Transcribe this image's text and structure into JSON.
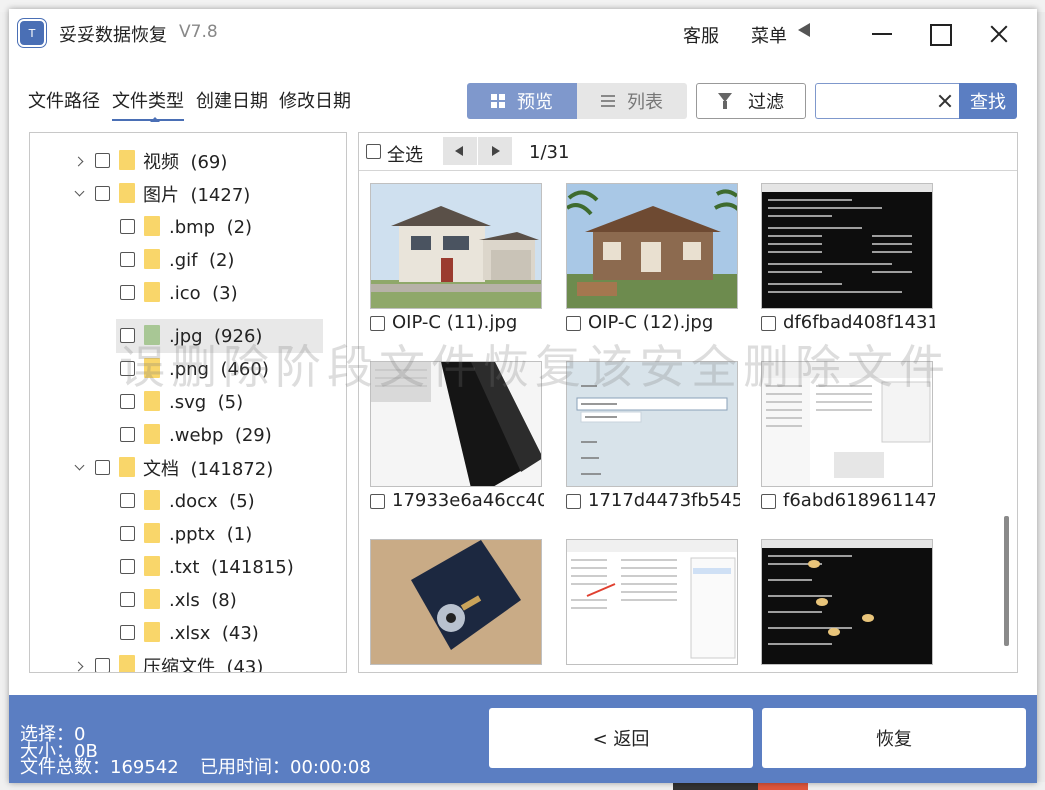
{
  "window": {
    "title": "妥妥数据恢复",
    "version": "V7.8",
    "logo_text": "T",
    "service_label": "客服",
    "menu_label": "菜单"
  },
  "tabs": [
    {
      "label": "文件路径",
      "active": false
    },
    {
      "label": "文件类型",
      "active": true
    },
    {
      "label": "创建日期",
      "active": false
    },
    {
      "label": "修改日期",
      "active": false
    }
  ],
  "toolbar": {
    "preview_label": "预览",
    "list_label": "列表",
    "filter_label": "过滤",
    "search_placeholder": "",
    "search_button": "查找"
  },
  "tree": [
    {
      "label": "视频",
      "count": "(69)",
      "expanded": false,
      "level": 0
    },
    {
      "label": "图片",
      "count": "(1427)",
      "expanded": true,
      "level": 0
    },
    {
      "label": ".bmp",
      "count": "(2)",
      "level": 1
    },
    {
      "label": ".gif",
      "count": "(2)",
      "level": 1
    },
    {
      "label": ".ico",
      "count": "(3)",
      "level": 1
    },
    {
      "label": ".jpg",
      "count": "(926)",
      "level": 1,
      "selected": true
    },
    {
      "label": ".png",
      "count": "(460)",
      "level": 1
    },
    {
      "label": ".svg",
      "count": "(5)",
      "level": 1
    },
    {
      "label": ".webp",
      "count": "(29)",
      "level": 1
    },
    {
      "label": "文档",
      "count": "(141872)",
      "expanded": true,
      "level": 0
    },
    {
      "label": ".docx",
      "count": "(5)",
      "level": 1
    },
    {
      "label": ".pptx",
      "count": "(1)",
      "level": 1
    },
    {
      "label": ".txt",
      "count": "(141815)",
      "level": 1
    },
    {
      "label": ".xls",
      "count": "(8)",
      "level": 1
    },
    {
      "label": ".xlsx",
      "count": "(43)",
      "level": 1
    },
    {
      "label": "压缩文件",
      "count": "(43)",
      "expanded": false,
      "level": 0
    }
  ],
  "grid": {
    "select_all_label": "全选",
    "page_indicator": "1/31",
    "items": [
      {
        "name": "OIP-C (11).jpg",
        "kind": "house-white"
      },
      {
        "name": "OIP-C (12).jpg",
        "kind": "house-wood"
      },
      {
        "name": "df6fbad408f1431",
        "kind": "terminal"
      },
      {
        "name": "17933e6a46cc40",
        "kind": "drive-black"
      },
      {
        "name": "1717d4473fb545",
        "kind": "dialog"
      },
      {
        "name": "f6abd618961147",
        "kind": "explorer"
      },
      {
        "name": "",
        "kind": "hdd"
      },
      {
        "name": "",
        "kind": "explorer-red"
      },
      {
        "name": "",
        "kind": "terminal-marks"
      }
    ]
  },
  "watermark": "误删除阶段文件恢复该安全删除文件",
  "footer": {
    "selected_label": "选择：0",
    "size_label": "大小：0B",
    "total_label": "文件总数：169542",
    "time_label": "已用时间：00:00:08",
    "back_button": "< 返回",
    "recover_button": "恢复"
  },
  "colors": {
    "accent": "#5b7ec2",
    "accent_light": "#7f98cc",
    "folder": "#f9d66a",
    "folder_selected": "#a8c795"
  }
}
